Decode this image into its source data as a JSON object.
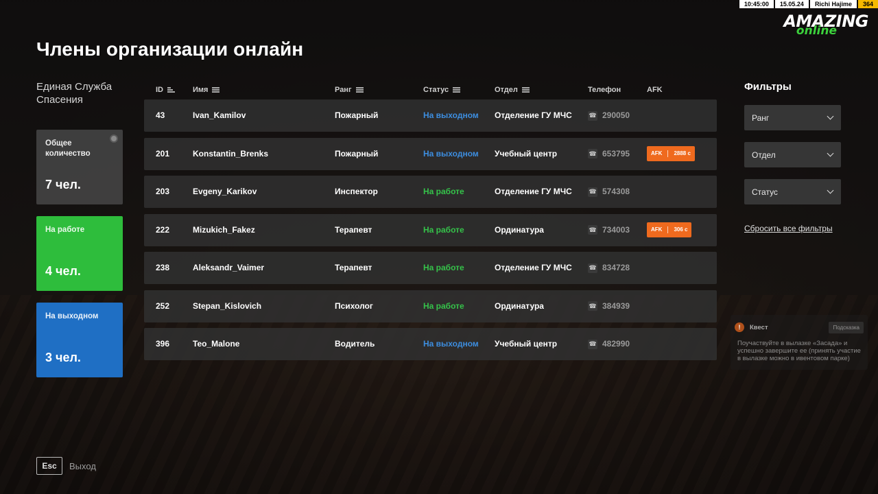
{
  "hud": {
    "time": "10:45:00",
    "date": "15.05.24",
    "player": "Richi Hajime",
    "money": "364"
  },
  "logo": {
    "main": "AMAZING",
    "sub": "online"
  },
  "page_title": "Члены организации онлайн",
  "organization": "Единая Служба Спасения",
  "stats": {
    "total": {
      "label": "Общее количество",
      "value": "7 чел."
    },
    "working": {
      "label": "На работе",
      "value": "4 чел."
    },
    "off_duty": {
      "label": "На выходном",
      "value": "3 чел."
    }
  },
  "table": {
    "headers": {
      "id": "ID",
      "name": "Имя",
      "rank": "Ранг",
      "status": "Статус",
      "dept": "Отдел",
      "phone": "Телефон",
      "afk": "AFK"
    },
    "rows": [
      {
        "id": "43",
        "name": "Ivan_Kamilov",
        "rank": "Пожарный",
        "status": "На выходном",
        "status_type": "off",
        "dept": "Отделение ГУ МЧС",
        "phone": "290050",
        "afk": ""
      },
      {
        "id": "201",
        "name": "Konstantin_Brenks",
        "rank": "Пожарный",
        "status": "На выходном",
        "status_type": "off",
        "dept": "Учебный центр",
        "phone": "653795",
        "afk": "2888 с"
      },
      {
        "id": "203",
        "name": "Evgeny_Karikov",
        "rank": "Инспектор",
        "status": "На работе",
        "status_type": "work",
        "dept": "Отделение ГУ МЧС",
        "phone": "574308",
        "afk": ""
      },
      {
        "id": "222",
        "name": "Mizukich_Fakez",
        "rank": "Терапевт",
        "status": "На работе",
        "status_type": "work",
        "dept": "Ординатура",
        "phone": "734003",
        "afk": "306 с"
      },
      {
        "id": "238",
        "name": "Aleksandr_Vaimer",
        "rank": "Терапевт",
        "status": "На работе",
        "status_type": "work",
        "dept": "Отделение ГУ МЧС",
        "phone": "834728",
        "afk": ""
      },
      {
        "id": "252",
        "name": "Stepan_Kislovich",
        "rank": "Психолог",
        "status": "На работе",
        "status_type": "work",
        "dept": "Ординатура",
        "phone": "384939",
        "afk": ""
      },
      {
        "id": "396",
        "name": "Teo_Malone",
        "rank": "Водитель",
        "status": "На выходном",
        "status_type": "off",
        "dept": "Учебный центр",
        "phone": "482990",
        "afk": ""
      }
    ],
    "afk_prefix": "AFK"
  },
  "filters": {
    "title": "Фильтры",
    "rank": "Ранг",
    "dept": "Отдел",
    "status": "Статус",
    "reset": "Сбросить все фильтры"
  },
  "quest": {
    "title": "Квест",
    "hint": "Подсказка",
    "text": "Поучаствуйте в вылазке «Засада» и успешно завершите ее (принять участие в вылазке можно в ивентовом парке)"
  },
  "footer": {
    "esc_key": "Esc",
    "esc_label": "Выход"
  },
  "colors": {
    "working": "#35c24a",
    "off_duty": "#3d8ee0",
    "afk": "#ef6a1e",
    "card_work": "#2ebd3c",
    "card_off": "#1f6fc4"
  }
}
